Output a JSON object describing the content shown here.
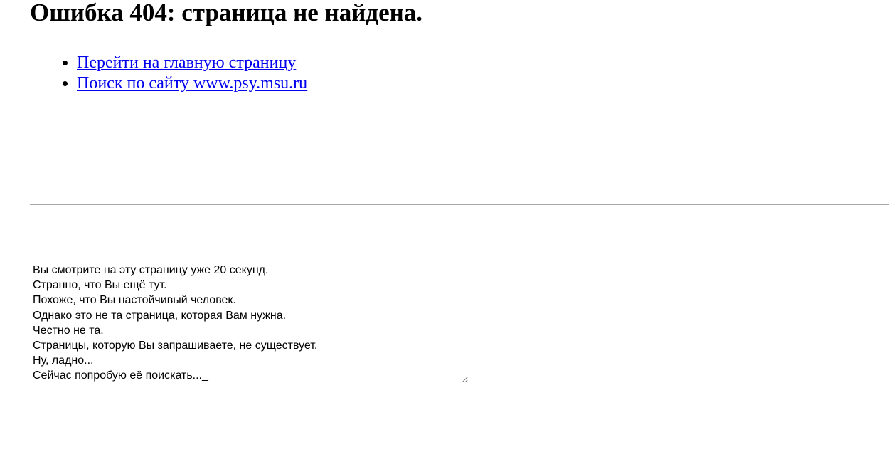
{
  "page": {
    "title": "Ошибка 404: страница не найдена."
  },
  "links": [
    {
      "label": "Перейти на главную страницу"
    },
    {
      "label": "Поиск по сайту www.psy.msu.ru"
    }
  ],
  "message": {
    "lines": [
      "Вы смотрите на эту страницу уже 20 секунд.",
      "Странно, что Вы ещё тут.",
      "Похоже, что Вы настойчивый человек.",
      "Однако это не та страница, которая Вам нужна.",
      "Честно не та.",
      "Страницы, которую Вы запрашиваете, не существует.",
      "Ну, ладно...",
      "Сейчас попробую её поискать..._"
    ]
  },
  "colors": {
    "link": "#0000ee",
    "divider": "#a8a8a8",
    "text": "#000000"
  }
}
